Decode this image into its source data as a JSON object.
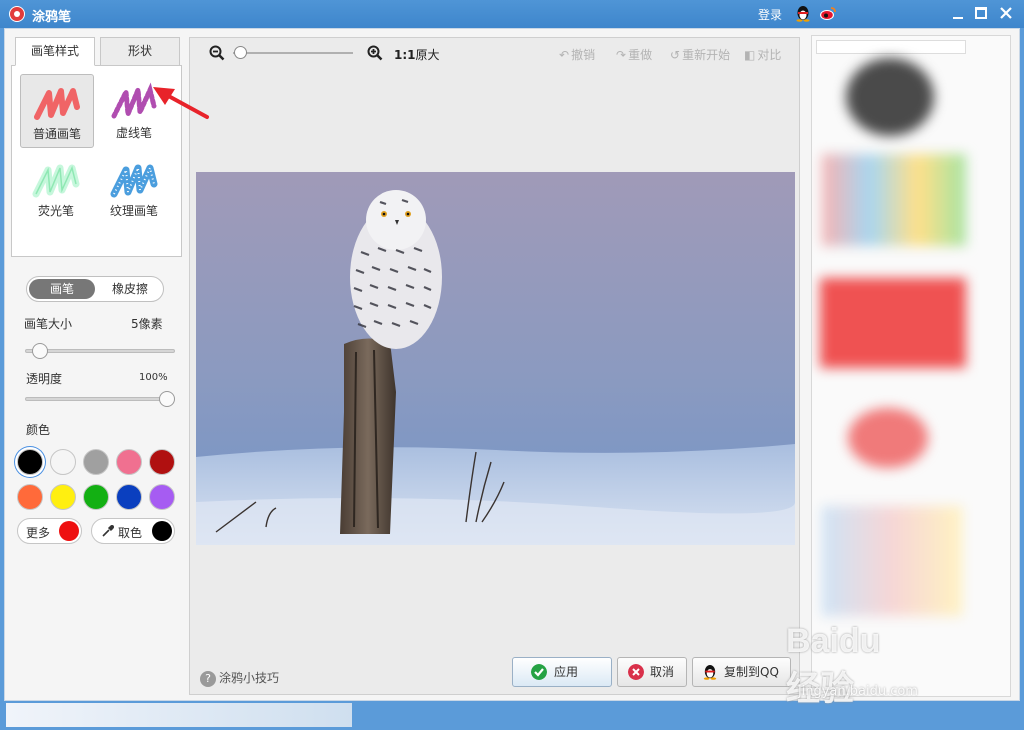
{
  "window": {
    "title": "涂鸦笔",
    "login": "登录",
    "qq_icon": "qq-penguin-icon",
    "weibo_icon": "weibo-icon"
  },
  "left_panel": {
    "tabs": [
      {
        "label": "画笔样式",
        "active": true
      },
      {
        "label": "形状",
        "active": false
      }
    ],
    "brushes": [
      {
        "label": "普通画笔",
        "selected": true,
        "color": "#f06466"
      },
      {
        "label": "虚线笔",
        "selected": false,
        "color": "#b04db0"
      },
      {
        "label": "荧光笔",
        "selected": false,
        "color": "#9ff0c0"
      },
      {
        "label": "纹理画笔",
        "selected": false,
        "color": "#4b9ede"
      }
    ],
    "mode_toggle": {
      "pen": "画笔",
      "eraser": "橡皮擦",
      "active": "pen"
    },
    "brush_size": {
      "label": "画笔大小",
      "value": "5像素",
      "level": 0.05
    },
    "opacity": {
      "label": "透明度",
      "value": "100%",
      "level": 1.0
    },
    "color_label": "颜色",
    "colors": [
      "#000000",
      "#f5f5f5",
      "#a0a0a0",
      "#f07090",
      "#b01010",
      "#ff6a3a",
      "#ffef10",
      "#13b013",
      "#0a3fbf",
      "#a65cf2"
    ],
    "selected_color": "#000000",
    "more": {
      "label": "更多",
      "color": "#ee1010"
    },
    "picker": {
      "label": "取色",
      "color": "#000000"
    }
  },
  "canvas": {
    "zoom_level": 0.05,
    "ratio": "1:1",
    "ratio_sub": "原大",
    "actions": [
      "撤销",
      "重做",
      "重新开始",
      "对比"
    ],
    "tips": "涂鸦小技巧",
    "buttons": {
      "apply": "应用",
      "cancel": "取消",
      "copy_qq": "复制到QQ"
    }
  },
  "watermark": {
    "brand": "Baidu经验",
    "url": "jingyan.baidu.com"
  }
}
